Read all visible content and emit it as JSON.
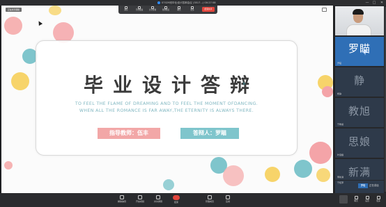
{
  "titlebar": {
    "title": "07029班毕业设计答辩会议 (3517...) 00:27:58",
    "window_controls": [
      "—",
      "□",
      "✕"
    ]
  },
  "float_toolbar": {
    "items": [
      {
        "label": "静音",
        "icon": "mic-icon"
      },
      {
        "label": "开启视频",
        "icon": "camera-icon"
      },
      {
        "label": "共享屏幕",
        "icon": "share-icon"
      },
      {
        "label": "管理成员",
        "icon": "members-icon"
      },
      {
        "label": "聊天",
        "icon": "chat-icon"
      },
      {
        "label": "更多",
        "icon": "more-icon"
      }
    ],
    "end_label": "结束共享"
  },
  "stage": {
    "tag": "正在共享屏幕",
    "title": "毕业设计答辩",
    "sub_line1": "TO FEEL THE FLAME OF DREAMING AND TO FEEL THE MOMENT OFDANCING.",
    "sub_line2": "WHEN ALL THE ROMANCE IS FAR AWAY,THE ETERNITY IS ALWAYS THERE.",
    "advisor": "指导教师：伍丰",
    "defender": "答辩人：罗瞄"
  },
  "sidebar": {
    "tiles": [
      {
        "name": "",
        "big": "",
        "kind": "camera"
      },
      {
        "name": "罗瞄",
        "big": "罗瞄",
        "kind": "active"
      },
      {
        "name": "杨静",
        "big": "静",
        "kind": "avatar"
      },
      {
        "name": "于教旭",
        "big": "教旭",
        "kind": "avatar"
      },
      {
        "name": "叶思娘",
        "big": "思娘",
        "kind": "avatar"
      },
      {
        "name": "李新满",
        "big": "新满",
        "kind": "avatar"
      },
      {
        "name": "于桂萍",
        "big": "",
        "kind": "avatar"
      }
    ],
    "footer_avatar": "罗瞄",
    "footer_text": "正在讲话"
  },
  "bottombar": {
    "left_info": "",
    "controls": [
      {
        "label": "解除静音",
        "icon": "mic-icon"
      },
      {
        "label": "开启视频",
        "icon": "camera-icon"
      },
      {
        "label": "共享屏幕",
        "icon": "share-icon"
      },
      {
        "label": "结束",
        "icon": "hangup-icon"
      },
      {
        "label": "管理成员",
        "icon": "members-icon"
      },
      {
        "label": "应用",
        "icon": "apps-icon"
      }
    ],
    "right_controls": [
      {
        "label": "聊天",
        "icon": "chat-icon"
      },
      {
        "label": "设置",
        "icon": "settings-icon"
      },
      {
        "label": "更多",
        "icon": "more-icon"
      }
    ]
  },
  "colors": {
    "pink": "#f2a7a7",
    "teal": "#7fc5cc",
    "yellow": "#f6d56a",
    "hangup": "#e2453c",
    "title_dark": "#3b3b3b"
  }
}
